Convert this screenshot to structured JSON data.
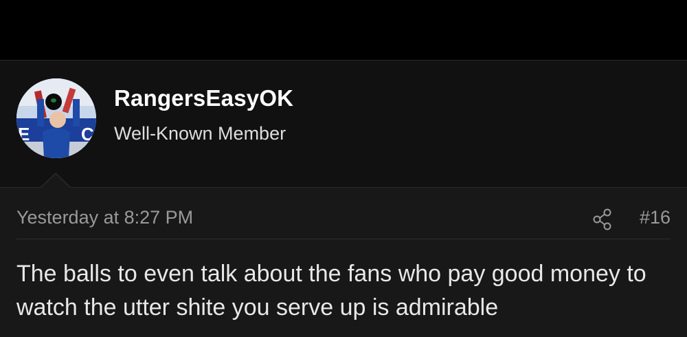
{
  "user": {
    "username": "RangersEasyOK",
    "title": "Well-Known Member",
    "avatar_icon": "user-avatar-photo"
  },
  "post": {
    "date": "Yesterday at 8:27 PM",
    "number": "#16",
    "share_icon": "share-icon",
    "body": "The balls to even talk about the fans who pay good money to watch the utter shite you serve up is admirable"
  },
  "colors": {
    "background": "#000000",
    "user_block_bg": "#111111",
    "post_bg": "#181818",
    "muted_text": "#9a9a9a",
    "body_text": "#e8e8e8"
  }
}
